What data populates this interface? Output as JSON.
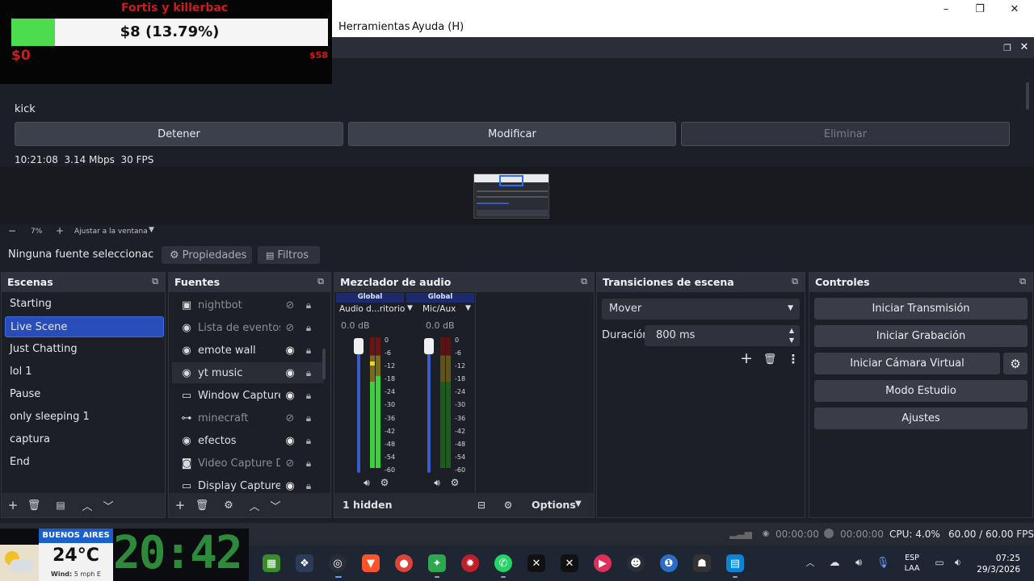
{
  "menu": {
    "items": [
      "Herramientas",
      "Ayuda (H)"
    ]
  },
  "window": {
    "minimize": "–",
    "maximize": "❐",
    "close": "✕"
  },
  "output": {
    "name": "kick",
    "buttons": {
      "stop": "Detener",
      "modify": "Modificar",
      "delete": "Eliminar"
    },
    "stats": "10:21:08  3.14 Mbps  30 FPS"
  },
  "zoom": {
    "minus": "−",
    "level": "7%",
    "plus": "+",
    "fit": "Ajustar a la ventana"
  },
  "source_toolbar": {
    "selected": "Ninguna fuente seleccionac",
    "properties": "Propiedades",
    "filters": "Filtros"
  },
  "scenes": {
    "title": "Escenas",
    "items": [
      "Starting",
      "Live Scene",
      "Just Chatting",
      "lol 1",
      "Pause",
      "only sleeping 1",
      "captura",
      "End"
    ],
    "active": "Live Scene"
  },
  "sources": {
    "title": "Fuentes",
    "items": [
      {
        "label": "nightbot",
        "icon": "browser-window-icon",
        "visible": false
      },
      {
        "label": "Lista de eventos",
        "icon": "globe-icon",
        "visible": false
      },
      {
        "label": "emote wall",
        "icon": "globe-icon",
        "visible": true
      },
      {
        "label": "yt music",
        "icon": "globe-icon",
        "visible": true
      },
      {
        "label": "Window Capture (",
        "icon": "window-icon",
        "visible": true
      },
      {
        "label": "minecraft",
        "icon": "gamepad-icon",
        "visible": false
      },
      {
        "label": "efectos",
        "icon": "globe-icon",
        "visible": true
      },
      {
        "label": "Video Capture Dev",
        "icon": "camera-icon",
        "visible": false
      },
      {
        "label": "Display Capture (1",
        "icon": "monitor-icon",
        "visible": true
      }
    ]
  },
  "mixer": {
    "title": "Mezclador de audio",
    "channels": [
      {
        "tag": "Global",
        "name": "Audio d...ritorio",
        "db": "0.0 dB"
      },
      {
        "tag": "Global",
        "name": "Mic/Aux",
        "db": "0.0 dB"
      }
    ],
    "scale": [
      "0",
      "-6",
      "-12",
      "-18",
      "-24",
      "-30",
      "-36",
      "-42",
      "-48",
      "-54",
      "-60"
    ],
    "hidden": "1 hidden",
    "options": "Options"
  },
  "transitions": {
    "title": "Transiciones de escena",
    "selected": "Mover",
    "duration_label": "Duración",
    "duration": "800 ms"
  },
  "controls": {
    "title": "Controles",
    "buttons": [
      "Iniciar Transmisión",
      "Iniciar Grabación",
      "Iniciar Cámara Virtual",
      "Modo Estudio",
      "Ajustes"
    ]
  },
  "status": {
    "stream_time": "00:00:00",
    "rec_time": "00:00:00",
    "cpu": "CPU: 4.0%",
    "fps": "60.00 / 60.00 FPS"
  },
  "goal_overlay": {
    "title": "Fortis y killerbac",
    "amount": "$8 (13.79%)",
    "min": "$0",
    "max": "$58",
    "progress_percent": 13.79
  },
  "weather_overlay": {
    "city": "BUENOS AIRES",
    "temp": "24°C",
    "wind": "Wind:",
    "wind_value": "5 mph E",
    "clock": "20:42"
  },
  "tray": {
    "lang_top": "ESP",
    "lang_bottom": "LAA",
    "time": "07:25",
    "date": "29/3/2026"
  },
  "colors": {
    "accent": "#284cb8",
    "goal_bar": "#4ddc4d",
    "goal_title": "#d11a1a"
  }
}
